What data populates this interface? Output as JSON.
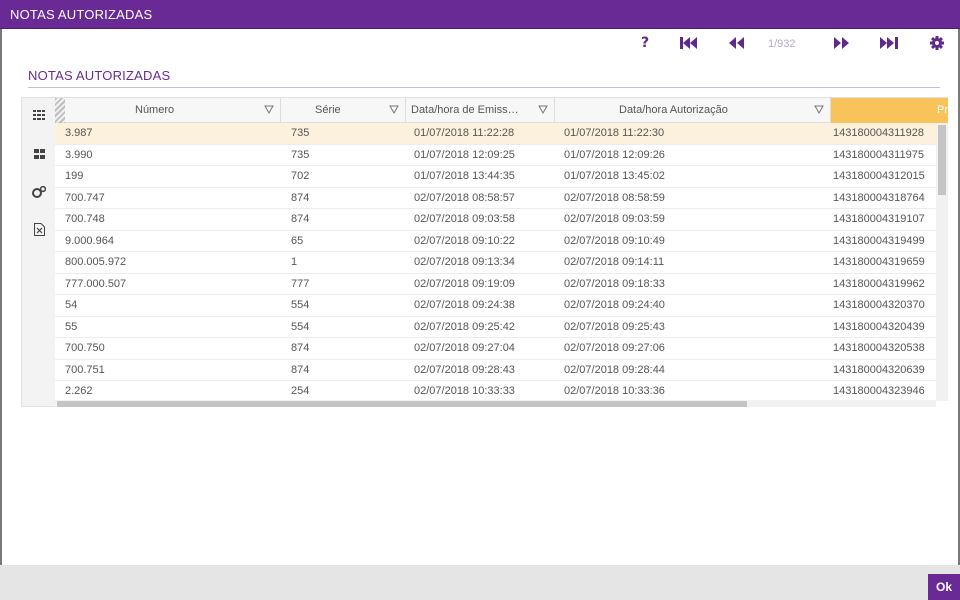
{
  "window": {
    "title": "NOTAS AUTORIZADAS"
  },
  "toolbar": {
    "help_label": "?",
    "page_indicator": "1/932",
    "icons": [
      "help-icon",
      "first-page-icon",
      "previous-page-icon",
      "next-page-icon",
      "last-page-icon",
      "gear-icon"
    ]
  },
  "section": {
    "title": "NOTAS AUTORIZADAS"
  },
  "sidebar": {
    "icons": [
      "grid-view-icon",
      "group-view-icon",
      "settings-cog-icon",
      "export-excel-icon"
    ]
  },
  "grid": {
    "columns": [
      "Número",
      "Série",
      "Data/hora de Emiss…",
      "Data/hora Autorização",
      "Pr"
    ],
    "rows": [
      [
        "3.987",
        "735",
        "01/07/2018 11:22:28",
        "01/07/2018 11:22:30",
        "143180004311928"
      ],
      [
        "3.990",
        "735",
        "01/07/2018 12:09:25",
        "01/07/2018 12:09:26",
        "143180004311975"
      ],
      [
        "199",
        "702",
        "01/07/2018 13:44:35",
        "01/07/2018 13:45:02",
        "143180004312015"
      ],
      [
        "700.747",
        "874",
        "02/07/2018 08:58:57",
        "02/07/2018 08:58:59",
        "143180004318764"
      ],
      [
        "700.748",
        "874",
        "02/07/2018 09:03:58",
        "02/07/2018 09:03:59",
        "143180004319107"
      ],
      [
        "9.000.964",
        "65",
        "02/07/2018 09:10:22",
        "02/07/2018 09:10:49",
        "143180004319499"
      ],
      [
        "800.005.972",
        "1",
        "02/07/2018 09:13:34",
        "02/07/2018 09:14:11",
        "143180004319659"
      ],
      [
        "777.000.507",
        "777",
        "02/07/2018 09:19:09",
        "02/07/2018 09:18:33",
        "143180004319962"
      ],
      [
        "54",
        "554",
        "02/07/2018 09:24:38",
        "02/07/2018 09:24:40",
        "143180004320370"
      ],
      [
        "55",
        "554",
        "02/07/2018 09:25:42",
        "02/07/2018 09:25:43",
        "143180004320439"
      ],
      [
        "700.750",
        "874",
        "02/07/2018 09:27:04",
        "02/07/2018 09:27:06",
        "143180004320538"
      ],
      [
        "700.751",
        "874",
        "02/07/2018 09:28:43",
        "02/07/2018 09:28:44",
        "143180004320639"
      ],
      [
        "2.262",
        "254",
        "02/07/2018 10:33:33",
        "02/07/2018 10:33:36",
        "143180004323946"
      ]
    ],
    "selected_row": 0
  },
  "footer": {
    "ok_label": "Ok"
  },
  "colors": {
    "brand": "#6a2a96",
    "highlight_header": "#f7c35a",
    "selected_row": "#fcf1dc"
  }
}
